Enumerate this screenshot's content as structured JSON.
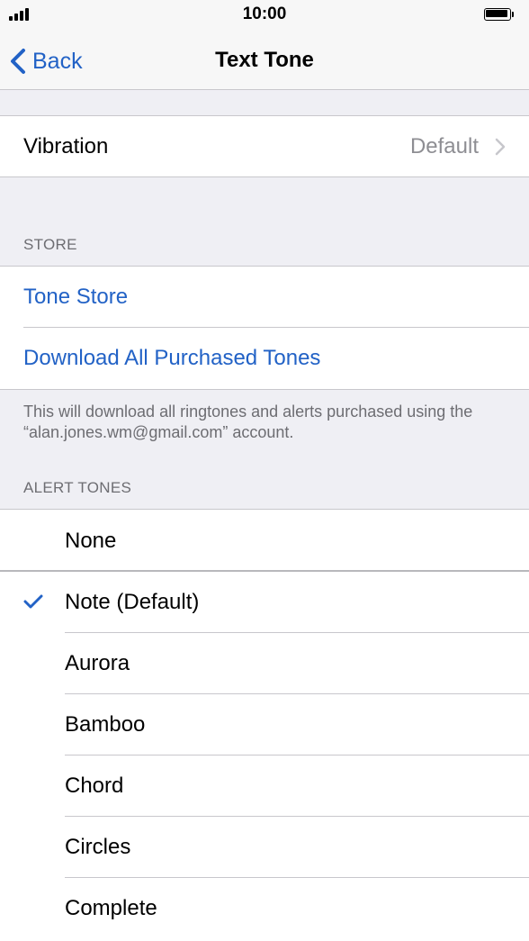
{
  "status_bar": {
    "time": "10:00"
  },
  "nav": {
    "back_label": "Back",
    "title": "Text Tone"
  },
  "vibration": {
    "label": "Vibration",
    "value": "Default"
  },
  "store": {
    "header": "STORE",
    "items": [
      "Tone Store",
      "Download All Purchased Tones"
    ],
    "footer": "This will download all ringtones and alerts purchased using the “alan.jones.wm@gmail.com” account."
  },
  "alert_tones": {
    "header": "ALERT TONES",
    "items": [
      {
        "label": "None",
        "selected": false
      },
      {
        "label": "Note (Default)",
        "selected": true
      },
      {
        "label": "Aurora",
        "selected": false
      },
      {
        "label": "Bamboo",
        "selected": false
      },
      {
        "label": "Chord",
        "selected": false
      },
      {
        "label": "Circles",
        "selected": false
      },
      {
        "label": "Complete",
        "selected": false
      }
    ]
  },
  "colors": {
    "accent": "#2262c6",
    "background": "#efeff4",
    "secondary_text": "#6d6d72"
  }
}
